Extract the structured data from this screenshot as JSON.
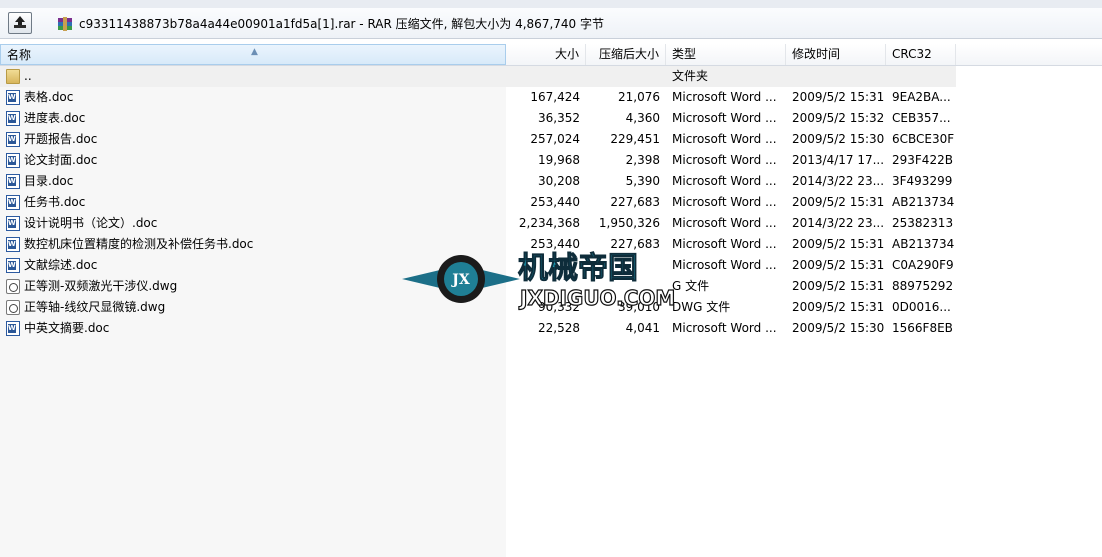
{
  "window": {
    "title": "c93311438873b78a4a44e00901a1fd5a[1].rar - RAR 压缩文件, 解包大小为 4,867,740 字节"
  },
  "toolbar": {
    "up_icon": "up-folder-icon",
    "archive_icon": "rar-archive-icon"
  },
  "columns": {
    "name": "名称",
    "size": "大小",
    "packed": "压缩后大小",
    "type": "类型",
    "modified": "修改时间",
    "crc": "CRC32"
  },
  "files": [
    {
      "icon": "folder-icon",
      "name": "..",
      "size": "",
      "packed": "",
      "type": "文件夹",
      "modified": "",
      "crc": ""
    },
    {
      "icon": "word-doc-icon",
      "name": "表格.doc",
      "size": "167,424",
      "packed": "21,076",
      "type": "Microsoft Word ...",
      "modified": "2009/5/2 15:31",
      "crc": "9EA2BA..."
    },
    {
      "icon": "word-doc-icon",
      "name": "进度表.doc",
      "size": "36,352",
      "packed": "4,360",
      "type": "Microsoft Word ...",
      "modified": "2009/5/2 15:32",
      "crc": "CEB357..."
    },
    {
      "icon": "word-doc-icon",
      "name": "开题报告.doc",
      "size": "257,024",
      "packed": "229,451",
      "type": "Microsoft Word ...",
      "modified": "2009/5/2 15:30",
      "crc": "6CBCE30F"
    },
    {
      "icon": "word-doc-icon",
      "name": "论文封面.doc",
      "size": "19,968",
      "packed": "2,398",
      "type": "Microsoft Word ...",
      "modified": "2013/4/17 17...",
      "crc": "293F422B"
    },
    {
      "icon": "word-doc-icon",
      "name": "目录.doc",
      "size": "30,208",
      "packed": "5,390",
      "type": "Microsoft Word ...",
      "modified": "2014/3/22 23...",
      "crc": "3F493299"
    },
    {
      "icon": "word-doc-icon",
      "name": "任务书.doc",
      "size": "253,440",
      "packed": "227,683",
      "type": "Microsoft Word ...",
      "modified": "2009/5/2 15:31",
      "crc": "AB213734"
    },
    {
      "icon": "word-doc-icon",
      "name": "设计说明书（论文）.doc",
      "size": "2,234,368",
      "packed": "1,950,326",
      "type": "Microsoft Word ...",
      "modified": "2014/3/22 23...",
      "crc": "25382313"
    },
    {
      "icon": "word-doc-icon",
      "name": "数控机床位置精度的检测及补偿任务书.doc",
      "size": "253,440",
      "packed": "227,683",
      "type": "Microsoft Word ...",
      "modified": "2009/5/2 15:31",
      "crc": "AB213734"
    },
    {
      "icon": "word-doc-icon",
      "name": "文献综述.doc",
      "size": "",
      "packed": "",
      "type": "Microsoft Word ...",
      "modified": "2009/5/2 15:31",
      "crc": "C0A290F9"
    },
    {
      "icon": "dwg-file-icon",
      "name": "正等测-双频激光干涉仪.dwg",
      "size": "",
      "packed": "",
      "type": "G 文件",
      "modified": "2009/5/2 15:31",
      "crc": "88975292"
    },
    {
      "icon": "dwg-file-icon",
      "name": "正等轴-线纹尺显微镜.dwg",
      "size": "90,332",
      "packed": "39,010",
      "type": "DWG 文件",
      "modified": "2009/5/2 15:31",
      "crc": "0D0016..."
    },
    {
      "icon": "word-doc-icon",
      "name": "中英文摘要.doc",
      "size": "22,528",
      "packed": "4,041",
      "type": "Microsoft Word ...",
      "modified": "2009/5/2 15:30",
      "crc": "1566F8EB"
    }
  ],
  "watermark": {
    "logo_text": "JX",
    "title": "机械帝国",
    "site": "JXDIGUO.COM"
  }
}
